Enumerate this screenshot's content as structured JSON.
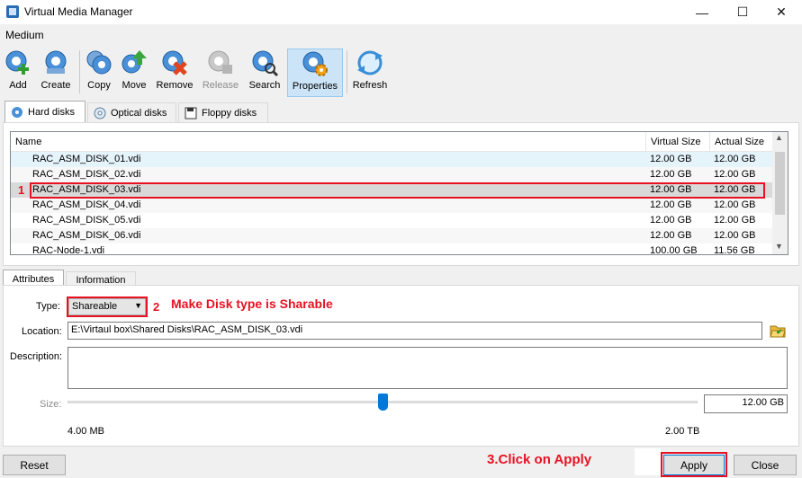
{
  "window": {
    "title": "Virtual Media Manager",
    "minimize": "—",
    "maximize": "☐",
    "close": "✕"
  },
  "menu": {
    "medium": "Medium"
  },
  "toolbar": {
    "add": "Add",
    "create": "Create",
    "copy": "Copy",
    "move": "Move",
    "remove": "Remove",
    "release": "Release",
    "search": "Search",
    "properties": "Properties",
    "refresh": "Refresh"
  },
  "media_tabs": {
    "hard_disks": "Hard disks",
    "optical_disks": "Optical disks",
    "floppy_disks": "Floppy disks"
  },
  "table": {
    "columns": {
      "name": "Name",
      "virtual_size": "Virtual Size",
      "actual_size": "Actual Size"
    },
    "rows": [
      {
        "name": "RAC_ASM_DISK_01.vdi",
        "virtual_size": "12.00 GB",
        "actual_size": "12.00 GB"
      },
      {
        "name": "RAC_ASM_DISK_02.vdi",
        "virtual_size": "12.00 GB",
        "actual_size": "12.00 GB"
      },
      {
        "name": "RAC_ASM_DISK_03.vdi",
        "virtual_size": "12.00 GB",
        "actual_size": "12.00 GB"
      },
      {
        "name": "RAC_ASM_DISK_04.vdi",
        "virtual_size": "12.00 GB",
        "actual_size": "12.00 GB"
      },
      {
        "name": "RAC_ASM_DISK_05.vdi",
        "virtual_size": "12.00 GB",
        "actual_size": "12.00 GB"
      },
      {
        "name": "RAC_ASM_DISK_06.vdi",
        "virtual_size": "12.00 GB",
        "actual_size": "12.00 GB"
      },
      {
        "name": "RAC-Node-1.vdi",
        "virtual_size": "100.00 GB",
        "actual_size": "11.56 GB"
      }
    ]
  },
  "detail_tabs": {
    "attributes": "Attributes",
    "information": "Information"
  },
  "attributes": {
    "type_label": "Type:",
    "type_value": "Shareable",
    "location_label": "Location:",
    "location_value": "E:\\Virtaul box\\Shared Disks\\RAC_ASM_DISK_03.vdi",
    "description_label": "Description:",
    "description_value": "",
    "size_label": "Size:",
    "size_value": "12.00 GB",
    "size_min": "4.00 MB",
    "size_max": "2.00 TB",
    "slider_fraction": 0.5
  },
  "buttons": {
    "reset": "Reset",
    "apply": "Apply",
    "close": "Close"
  },
  "annotations": {
    "step1": "1",
    "step2": "2",
    "step2_text": "Make Disk type is Sharable",
    "step3_text": "3.Click on Apply"
  },
  "colors": {
    "annotation_red": "#e81123",
    "selection_gray": "#d9d9d9",
    "accent_blue": "#0078d7"
  }
}
